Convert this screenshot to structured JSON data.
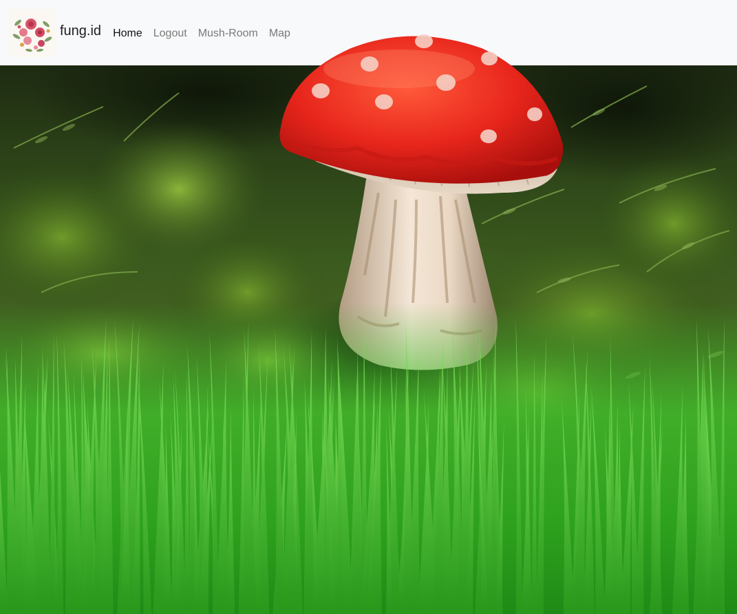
{
  "navbar": {
    "brand": {
      "name": "fung.id",
      "logo_icon": "floral-wreath-logo"
    },
    "links": [
      {
        "label": "Home",
        "active": true
      },
      {
        "label": "Logout",
        "active": false
      },
      {
        "label": "Mush-Room",
        "active": false
      },
      {
        "label": "Map",
        "active": false
      }
    ]
  },
  "hero": {
    "image": "red-fly-agaric-mushroom-in-forest-grass",
    "colors": {
      "cap": "#e8261c",
      "stem": "#e8d6c4",
      "grass": "#3fb82a",
      "forest": "#2f4a18"
    }
  }
}
